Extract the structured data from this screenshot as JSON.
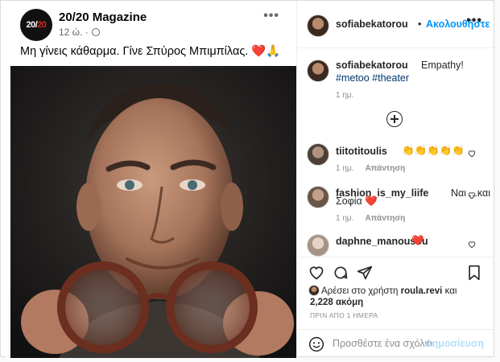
{
  "embedded_post": {
    "page_name": "20/20 Magazine",
    "avatar_text_white": "20/",
    "avatar_text_red": "20",
    "time": "12 ώ. ·",
    "more": "•••",
    "text": "Μη γίνεις κάθαρμα. Γίνε Σπύρος Μπιμπίλας.",
    "emojis": "❤️🙏"
  },
  "header": {
    "username": "sofiabekatorou",
    "dot": "•",
    "follow_label": "Ακολουθήστε",
    "more": "•••"
  },
  "caption": {
    "username": "sofiabekatorou",
    "text": "Empathy!",
    "hashtags": "#metoo #theater",
    "time": "1 ημ."
  },
  "comments": [
    {
      "username": "tiitotitoulis",
      "text": "👏👏👏👏👏",
      "time": "1 ημ.",
      "reply": "Απάντηση"
    },
    {
      "username": "fashion_is_my_liife",
      "text": "Ναι ...και",
      "text2": "Σοφία ❤️",
      "time": "1 ημ.",
      "reply": "Απάντηση"
    },
    {
      "username": "daphne_manousou",
      "text": "❤️"
    }
  ],
  "likes": {
    "prefix": "Αρέσει στο χρήστη",
    "user": "roula.revi",
    "and": "και",
    "count": "2,228 ακόμη"
  },
  "post_date": "ΠΡΙΝ ΑΠΟ 1 ΗΜΕΡΑ",
  "comment_box": {
    "placeholder": "Προσθέστε ένα σχόλιο...",
    "post_label": "Δημοσίευση"
  },
  "colors": {
    "accent": "#0095f6",
    "heart": "#ed4956",
    "muted": "#8e8e8e"
  }
}
